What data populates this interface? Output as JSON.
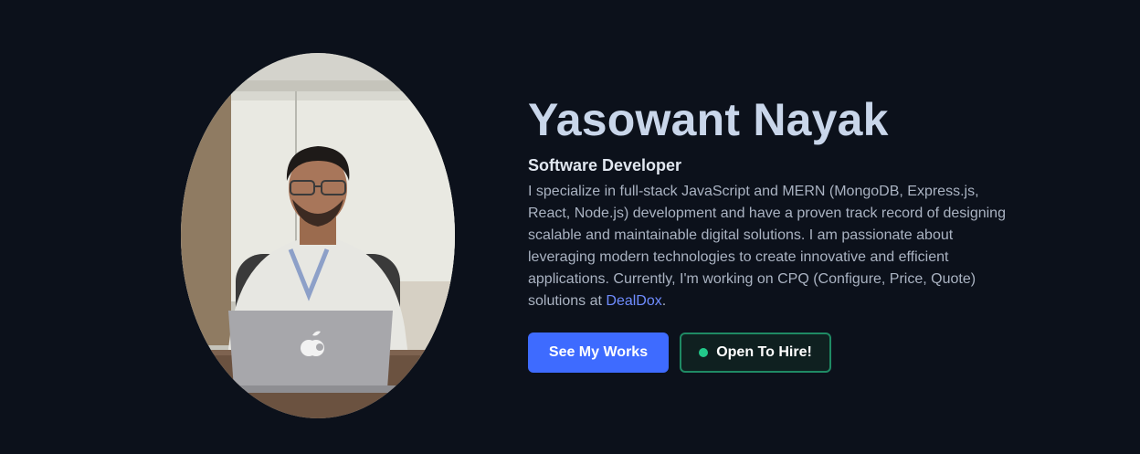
{
  "profile": {
    "name": "Yasowant Nayak",
    "role": "Software Developer",
    "bio_text": "I specialize in full-stack JavaScript and MERN (MongoDB, Express.js, React, Node.js) development and have a proven track record of designing scalable and maintainable digital solutions. I am passionate about leveraging modern technologies to create innovative and efficient applications. Currently, I'm working on CPQ (Configure, Price, Quote) solutions at ",
    "company_link": "DealDox",
    "bio_end": "."
  },
  "actions": {
    "primary_label": "See My Works",
    "secondary_label": "Open To Hire!"
  },
  "colors": {
    "background": "#0c111b",
    "name": "#c9d6ea",
    "accent": "#3e6bff",
    "link": "#6f8cff",
    "status_green": "#22c98a"
  }
}
